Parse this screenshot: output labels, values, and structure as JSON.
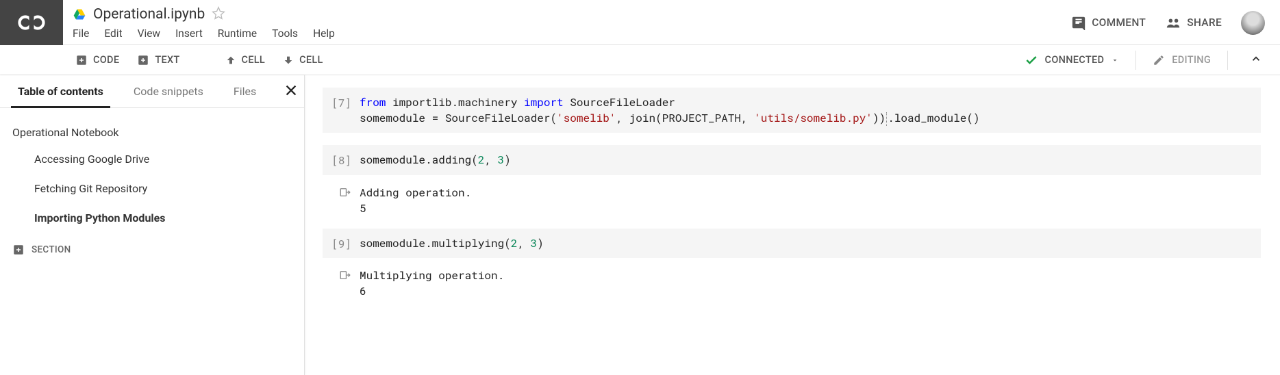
{
  "header": {
    "title": "Operational.ipynb",
    "menus": [
      "File",
      "Edit",
      "View",
      "Insert",
      "Runtime",
      "Tools",
      "Help"
    ],
    "comment": "COMMENT",
    "share": "SHARE"
  },
  "toolbar": {
    "code": "CODE",
    "text": "TEXT",
    "cell_up": "CELL",
    "cell_down": "CELL",
    "connected": "CONNECTED",
    "editing": "EDITING"
  },
  "sidebar": {
    "tabs": [
      "Table of contents",
      "Code snippets",
      "Files"
    ],
    "toc": {
      "h1": "Operational Notebook",
      "items": [
        {
          "label": "Accessing Google Drive",
          "active": false
        },
        {
          "label": "Fetching Git Repository",
          "active": false
        },
        {
          "label": "Importing Python Modules",
          "active": true
        }
      ]
    },
    "add_section": "SECTION"
  },
  "cells": [
    {
      "prompt": "[7]",
      "code_tokens": [
        {
          "t": "from ",
          "c": "kw"
        },
        {
          "t": "importlib.machinery "
        },
        {
          "t": "import ",
          "c": "kw"
        },
        {
          "t": "SourceFileLoader\n"
        },
        {
          "t": "somemodule = SourceFileLoader("
        },
        {
          "t": "'somelib'",
          "c": "str"
        },
        {
          "t": ", join(PROJECT_PATH, "
        },
        {
          "t": "'utils/somelib.py'",
          "c": "str"
        },
        {
          "t": "))"
        },
        {
          "t": "",
          "cursor": true
        },
        {
          "t": ".load_module()"
        }
      ]
    },
    {
      "prompt": "[8]",
      "code_tokens": [
        {
          "t": "somemodule.adding("
        },
        {
          "t": "2",
          "c": "num"
        },
        {
          "t": ", "
        },
        {
          "t": "3",
          "c": "num"
        },
        {
          "t": ")"
        }
      ],
      "output": "Adding operation.\n5"
    },
    {
      "prompt": "[9]",
      "code_tokens": [
        {
          "t": "somemodule.multiplying("
        },
        {
          "t": "2",
          "c": "num"
        },
        {
          "t": ", "
        },
        {
          "t": "3",
          "c": "num"
        },
        {
          "t": ")"
        }
      ],
      "output": "Multiplying operation.\n6"
    }
  ]
}
